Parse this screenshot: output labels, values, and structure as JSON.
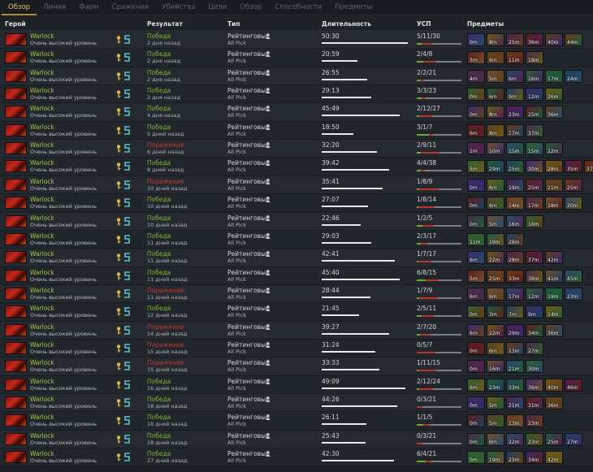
{
  "tabs": [
    "Обзор",
    "Линия",
    "Фарм",
    "Сражения",
    "Убийства",
    "Цели",
    "Обзор",
    "Способности",
    "Предметы"
  ],
  "columns": {
    "hero": "Герой",
    "result": "Результат",
    "type": "Тип",
    "duration": "Длительность",
    "kda": "УСП",
    "items": "Предметы"
  },
  "colors": {
    "win": "#86b52e",
    "loss": "#c63a2d",
    "hero_name": "#a5c840",
    "tab_active": "#e7c06a",
    "kda_kills": "#6fa92f",
    "kda_deaths": "#b8352b",
    "kda_assists": "#7a7f85"
  },
  "icons": {
    "hero_portrait": "warlock-portrait",
    "role": "key-icon",
    "lane": "lane-icon",
    "party": "person-icon"
  },
  "item_icon_palette": [
    "#3a2a6a",
    "#6a3a1a",
    "#1f5a3a",
    "#5a1f1f",
    "#2a4a6a",
    "#6a5a1a",
    "#4a2a4a",
    "#1f3f5f",
    "#5f3f1f",
    "#2f5f2f",
    "#4f1f4f",
    "#6f4f2f"
  ],
  "matches": [
    {
      "hero": "Warlock",
      "level": "Очень высокий уровень",
      "result": "Победа",
      "win": true,
      "ago": "2 дня назад",
      "type": "Рейтинговый",
      "mode": "All Pick",
      "duration": "50:30",
      "dur_min": 50.5,
      "kda": "5/11/30",
      "items": [
        "0m",
        "8m",
        "25m",
        "36m",
        "40m",
        "44m"
      ]
    },
    {
      "hero": "Warlock",
      "level": "Очень высокий уровень",
      "result": "Победа",
      "win": true,
      "ago": "2 дня назад",
      "type": "Рейтинговый",
      "mode": "All Pick",
      "duration": "20:59",
      "dur_min": 21.0,
      "kda": "2/4/8",
      "items": [
        "3m",
        "6m",
        "11m",
        "18m"
      ]
    },
    {
      "hero": "Warlock",
      "level": "Очень высокий уровень",
      "result": "Победа",
      "win": true,
      "ago": "2 дня назад",
      "type": "Рейтинговый",
      "mode": "All Pick",
      "duration": "26:55",
      "dur_min": 26.9,
      "kda": "2/2/21",
      "items": [
        "4m",
        "5m",
        "6m",
        "16m",
        "17m",
        "24m"
      ]
    },
    {
      "hero": "Warlock",
      "level": "Очень высокий уровень",
      "result": "Победа",
      "win": true,
      "ago": "2 дня назад",
      "type": "Рейтинговый",
      "mode": "All Pick",
      "duration": "29:13",
      "dur_min": 29.2,
      "kda": "3/3/23",
      "items": [
        "0m",
        "6m",
        "9m",
        "12m",
        "26m"
      ]
    },
    {
      "hero": "Warlock",
      "level": "Очень высокий уровень",
      "result": "Победа",
      "win": true,
      "ago": "4 дня назад",
      "type": "Рейтинговый",
      "mode": "All Pick",
      "duration": "45:49",
      "dur_min": 45.8,
      "kda": "2/12/27",
      "items": [
        "0m",
        "8m",
        "23m",
        "25m",
        "36m"
      ]
    },
    {
      "hero": "Warlock",
      "level": "Очень высокий уровень",
      "result": "Победа",
      "win": true,
      "ago": "5 дней назад",
      "type": "Рейтинговый",
      "mode": "All Pick",
      "duration": "18:50",
      "dur_min": 18.8,
      "kda": "3/1/7",
      "items": [
        "6m",
        "8m",
        "17m",
        "37m"
      ]
    },
    {
      "hero": "Warlock",
      "level": "Очень высокий уровень",
      "result": "Поражение",
      "win": false,
      "ago": "6 дней назад",
      "type": "Рейтинговый",
      "mode": "All Pick",
      "duration": "32:20",
      "dur_min": 32.3,
      "kda": "2/9/11",
      "items": [
        "1m",
        "10m",
        "15m",
        "15m",
        "22m"
      ]
    },
    {
      "hero": "Warlock",
      "level": "Очень высокий уровень",
      "result": "Победа",
      "win": true,
      "ago": "8 дней назад",
      "type": "Рейтинговый",
      "mode": "All Pick",
      "duration": "39:42",
      "dur_min": 39.7,
      "kda": "4/4/38",
      "items": [
        "5m",
        "29m",
        "25m",
        "30m",
        "28m",
        "35m",
        "37m"
      ]
    },
    {
      "hero": "Warlock",
      "level": "Очень высокий уровень",
      "result": "Поражение",
      "win": false,
      "ago": "10 дней назад",
      "type": "Рейтинговый",
      "mode": "All Pick",
      "duration": "35:41",
      "dur_min": 35.7,
      "kda": "1/8/9",
      "items": [
        "0m",
        "6m",
        "19m",
        "25m",
        "21m",
        "25m"
      ]
    },
    {
      "hero": "Warlock",
      "level": "Очень высокий уровень",
      "result": "Победа",
      "win": true,
      "ago": "10 дней назад",
      "type": "Рейтинговый",
      "mode": "All Pick",
      "duration": "27:07",
      "dur_min": 27.1,
      "kda": "1/8/14",
      "items": [
        "0m",
        "6m",
        "14m",
        "17m",
        "18m",
        "20m"
      ]
    },
    {
      "hero": "Warlock",
      "level": "Очень высокий уровень",
      "result": "Победа",
      "win": true,
      "ago": "10 дней назад",
      "type": "Рейтинговый",
      "mode": "All Pick",
      "duration": "22:46",
      "dur_min": 22.8,
      "kda": "1/2/5",
      "items": [
        "0m",
        "5m",
        "16m",
        "16m"
      ]
    },
    {
      "hero": "Warlock",
      "level": "Очень высокий уровень",
      "result": "Победа",
      "win": true,
      "ago": "11 дней назад",
      "type": "Рейтинговый",
      "mode": "All Pick",
      "duration": "29:03",
      "dur_min": 29.1,
      "kda": "2/3/17",
      "items": [
        "11m",
        "19m",
        "28m"
      ]
    },
    {
      "hero": "Warlock",
      "level": "Очень высокий уровень",
      "result": "Победа",
      "win": true,
      "ago": "11 дней назад",
      "type": "Рейтинговый",
      "mode": "All Pick",
      "duration": "42:41",
      "dur_min": 42.7,
      "kda": "1/7/17",
      "items": [
        "6m",
        "22m",
        "28m",
        "37m",
        "42m"
      ]
    },
    {
      "hero": "Warlock",
      "level": "Очень высокий уровень",
      "result": "Победа",
      "win": true,
      "ago": "11 дней назад",
      "type": "Рейтинговый",
      "mode": "All Pick",
      "duration": "45:40",
      "dur_min": 45.7,
      "kda": "6/8/15",
      "items": [
        "5m",
        "25m",
        "33m",
        "38m",
        "41m",
        "45m"
      ]
    },
    {
      "hero": "Warlock",
      "level": "Очень высокий уровень",
      "result": "Поражение",
      "win": false,
      "ago": "11 дней назад",
      "type": "Рейтинговый",
      "mode": "All Pick",
      "duration": "28:44",
      "dur_min": 28.7,
      "kda": "1/7/9",
      "items": [
        "6m",
        "6m",
        "17m",
        "12m",
        "19m",
        "23m"
      ]
    },
    {
      "hero": "Warlock",
      "level": "Очень высокий уровень",
      "result": "Победа",
      "win": true,
      "ago": "12 дней назад",
      "type": "Рейтинговый",
      "mode": "All Pick",
      "duration": "21:45",
      "dur_min": 21.8,
      "kda": "2/5/11",
      "items": [
        "0m",
        "3m",
        "7m",
        "9m",
        "14m"
      ]
    },
    {
      "hero": "Warlock",
      "level": "Очень высокий уровень",
      "result": "Поражение",
      "win": false,
      "ago": "14 дней назад",
      "type": "Рейтинговый",
      "mode": "All Pick",
      "duration": "39:27",
      "dur_min": 39.5,
      "kda": "2/7/20",
      "items": [
        "6m",
        "22m",
        "29m",
        "34m",
        "36m"
      ]
    },
    {
      "hero": "Warlock",
      "level": "Очень высокий уровень",
      "result": "Поражение",
      "win": false,
      "ago": "15 дней назад",
      "type": "Рейтинговый",
      "mode": "All Pick",
      "duration": "31:24",
      "dur_min": 31.4,
      "kda": "0/5/7",
      "items": [
        "0m",
        "6m",
        "13m",
        "27m"
      ]
    },
    {
      "hero": "Warlock",
      "level": "Очень высокий уровень",
      "result": "Поражение",
      "win": false,
      "ago": "15 дней назад",
      "type": "Рейтинговый",
      "mode": "All Pick",
      "duration": "33:33",
      "dur_min": 33.6,
      "kda": "1/11/15",
      "items": [
        "0m",
        "16m",
        "21m",
        "30m"
      ]
    },
    {
      "hero": "Warlock",
      "level": "Очень высокий уровень",
      "result": "Победа",
      "win": true,
      "ago": "16 дней назад",
      "type": "Рейтинговый",
      "mode": "All Pick",
      "duration": "49:09",
      "dur_min": 49.2,
      "kda": "2/12/24",
      "items": [
        "6m",
        "23m",
        "33m",
        "36m",
        "40m",
        "46m"
      ]
    },
    {
      "hero": "Warlock",
      "level": "Очень высокий уровень",
      "result": "Победа",
      "win": true,
      "ago": "18 дней назад",
      "type": "Рейтинговый",
      "mode": "All Pick",
      "duration": "44:26",
      "dur_min": 44.4,
      "kda": "0/3/21",
      "items": [
        "0m",
        "5m",
        "21m",
        "31m",
        "36m"
      ]
    },
    {
      "hero": "Warlock",
      "level": "Очень высокий уровень",
      "result": "Победа",
      "win": true,
      "ago": "18 дней назад",
      "type": "Рейтинговый",
      "mode": "All Pick",
      "duration": "26:11",
      "dur_min": 26.2,
      "kda": "1/1/5",
      "items": [
        "0m",
        "5m",
        "13m",
        "23m"
      ]
    },
    {
      "hero": "Warlock",
      "level": "Очень высокий уровень",
      "result": "Победа",
      "win": true,
      "ago": "18 дней назад",
      "type": "Рейтинговый",
      "mode": "All Pick",
      "duration": "25:43",
      "dur_min": 25.7,
      "kda": "0/3/21",
      "items": [
        "0m",
        "6m",
        "22m",
        "23m",
        "25m",
        "27m"
      ]
    },
    {
      "hero": "Warlock",
      "level": "Очень высокий уровень",
      "result": "Победа",
      "win": true,
      "ago": "27 дней назад",
      "type": "Рейтинговый",
      "mode": "All Pick",
      "duration": "42:30",
      "dur_min": 42.5,
      "kda": "6/4/21",
      "items": [
        "0m",
        "19m",
        "23m",
        "34m",
        "42m"
      ]
    }
  ]
}
